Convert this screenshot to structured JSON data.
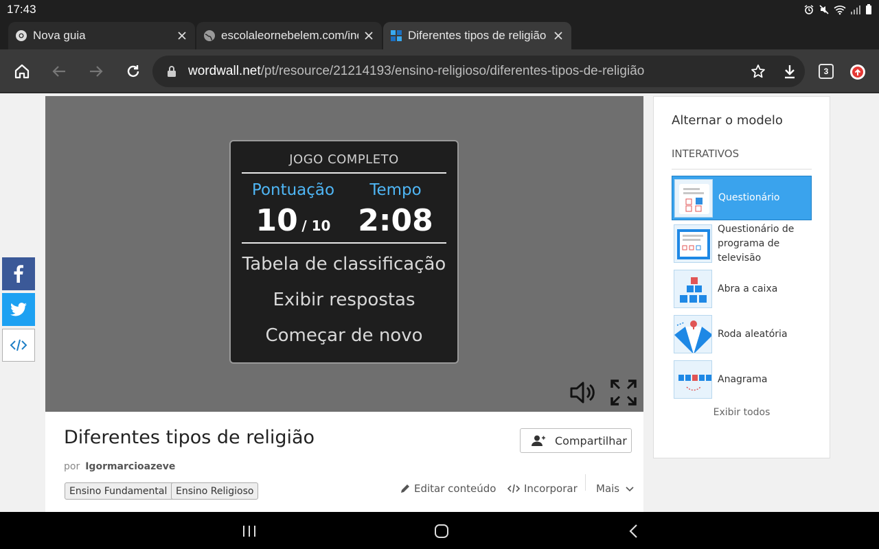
{
  "status": {
    "time": "17:43"
  },
  "tabs": [
    {
      "label": "Nova guia",
      "favicon": "chrome-icon",
      "active": false
    },
    {
      "label": "escolaleornebelem.com/index",
      "favicon": "globe-icon",
      "active": false
    },
    {
      "label": "Diferentes tipos de religião",
      "favicon": "wordwall-icon",
      "active": true
    }
  ],
  "omnibox": {
    "host": "wordwall.net",
    "path": "/pt/resource/21214193/ensino-religioso/diferentes-tipos-de-religião"
  },
  "toolbar": {
    "tab_count": "3"
  },
  "game": {
    "panel_title": "JOGO COMPLETO",
    "score_label": "Pontuação",
    "score_value": "10",
    "score_total": "/ 10",
    "time_label": "Tempo",
    "time_value": "2:08",
    "options": [
      "Tabela de classificação",
      "Exibir respostas",
      "Começar de novo"
    ]
  },
  "activity": {
    "title": "Diferentes tipos de religião",
    "share_label": "Compartilhar",
    "by_prefix": "por",
    "author": "Igormarcioazeve",
    "tags": [
      "Ensino Fundamental I",
      "Ensino Religioso"
    ],
    "actions": {
      "edit": "Editar conteúdo",
      "embed": "Incorporar",
      "more": "Mais"
    }
  },
  "sidebar": {
    "title": "Alternar o modelo",
    "section": "INTERATIVOS",
    "templates": [
      {
        "label": "Questionário",
        "active": true
      },
      {
        "label": "Questionário de programa de televisão",
        "active": false
      },
      {
        "label": "Abra a caixa",
        "active": false
      },
      {
        "label": "Roda aleatória",
        "active": false
      },
      {
        "label": "Anagrama",
        "active": false
      }
    ],
    "view_all": "Exibir todos"
  },
  "colors": {
    "accent": "#3aa3ed",
    "score_label": "#4fb6f5",
    "facebook": "#3b5998",
    "twitter": "#1da1f2"
  }
}
